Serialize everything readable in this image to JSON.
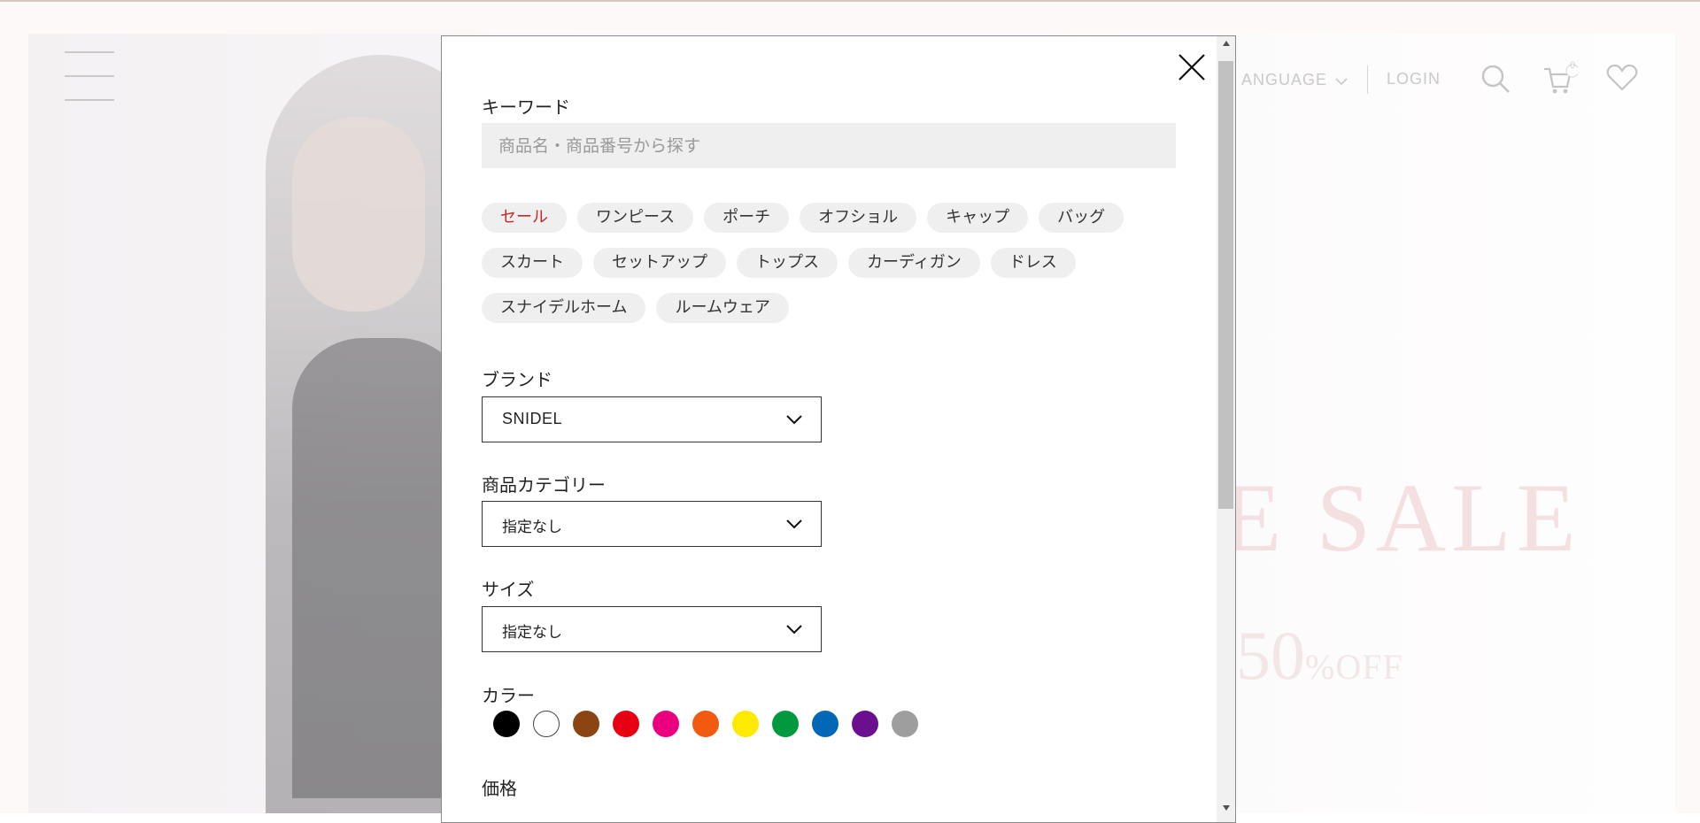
{
  "background": {
    "header": {
      "language_label": "ANGUAGE",
      "login_label": "LOGIN",
      "cart_count": "0"
    },
    "hero": {
      "sale_text": "E SALE",
      "off_number": "50",
      "off_unit": "%OFF"
    }
  },
  "modal": {
    "keyword": {
      "label": "キーワード",
      "placeholder": "商品名・商品番号から探す"
    },
    "tags": [
      [
        "セール",
        "ワンピース",
        "ポーチ",
        "オフショル",
        "キャップ",
        "バッグ"
      ],
      [
        "スカート",
        "セットアップ",
        "トップス",
        "カーディガン",
        "ドレス"
      ],
      [
        "スナイデルホーム",
        "ルームウェア"
      ]
    ],
    "brand": {
      "label": "ブランド",
      "value": "SNIDEL"
    },
    "category": {
      "label": "商品カテゴリー",
      "value": "指定なし"
    },
    "size": {
      "label": "サイズ",
      "value": "指定なし"
    },
    "color": {
      "label": "カラー",
      "swatches": [
        "#000000",
        "#ffffff",
        "#8b4513",
        "#e60012",
        "#ea007f",
        "#f25a0f",
        "#ffe900",
        "#009a3e",
        "#0068b7",
        "#6a0f8e",
        "#9e9e9e"
      ]
    },
    "price": {
      "label": "価格"
    }
  },
  "colors": {
    "sale_tag": "#c62828"
  }
}
